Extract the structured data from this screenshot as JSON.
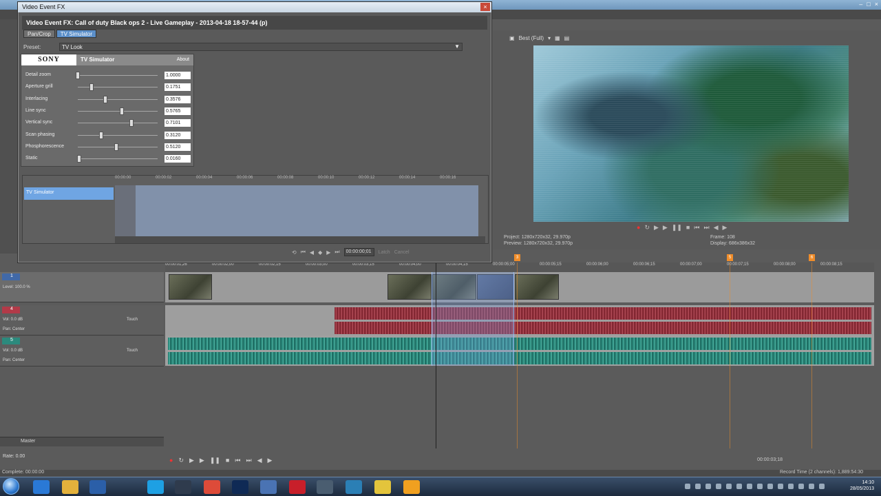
{
  "app": {
    "titlebar_text": ""
  },
  "fx_dialog": {
    "title": "Video Event FX",
    "close": "×",
    "header": "Video Event FX:  Call of duty Black ops 2 - Live Gameplay - 2013-04-18 18-57-44 (p)",
    "chain": [
      {
        "label": "Pan/Crop"
      },
      {
        "label": "TV Simulator"
      }
    ],
    "preset_label": "Preset:",
    "preset_value": "TV Look",
    "plugin": {
      "brand": "SONY",
      "name": "TV Simulator",
      "about": "About",
      "params": [
        {
          "label": "Detail zoom",
          "value": "1.0000",
          "level": 0.0
        },
        {
          "label": "Aperture grill",
          "value": "0.1751",
          "level": 0.18
        },
        {
          "label": "Interlacing",
          "value": "0.3576",
          "level": 0.36
        },
        {
          "label": "Line sync",
          "value": "0.5765",
          "level": 0.58
        },
        {
          "label": "Vertical sync",
          "value": "0.7101",
          "level": 0.71
        },
        {
          "label": "Scan phasing",
          "value": "0.3120",
          "level": 0.31
        },
        {
          "label": "Phosphorescence",
          "value": "0.5120",
          "level": 0.51
        },
        {
          "label": "Static",
          "value": "0.0160",
          "level": 0.02
        }
      ]
    },
    "keyframes": {
      "track_label": "TV Simulator",
      "ruler": [
        "00:00:00",
        "00:00:02",
        "00:00:04",
        "00:00:06",
        "00:00:08",
        "00:00:10",
        "00:00:12",
        "00:00:14",
        "00:00:16"
      ]
    },
    "time_value": "00:00:00;01",
    "latch": "Latch",
    "cancel": "Cancel"
  },
  "preview": {
    "quality": "Best (Full)",
    "project_label": "Project:",
    "project_value": "1280x720x32, 29.970p",
    "preview_label": "Preview:",
    "preview_value": "1280x720x32, 29.970p",
    "frame_label": "Frame:",
    "frame_value": "108",
    "display_label": "Display:",
    "display_value": "686x386x32"
  },
  "timeline": {
    "ruler": [
      "00:00:01;26",
      "00:00:02;00",
      "00:00:02;15",
      "00:00:03;00",
      "00:00:03;15",
      "00:00:04;00",
      "00:00:04;15",
      "00:00:05;00",
      "00:00:05;15",
      "00:00:06;00",
      "00:00:06;15",
      "00:00:07;00",
      "00:00:07;15",
      "00:00:08;00",
      "00:00:08;15"
    ],
    "markers": [
      "3",
      "5",
      "6"
    ],
    "tracks": [
      {
        "num": "1",
        "line1": "Level: 100.0 %"
      },
      {
        "num": "4",
        "line1": "Vol:      0.0 dB",
        "line2": "Pan:      Center",
        "mode": "Touch"
      },
      {
        "num": "5",
        "line1": "Vol:      0.0 dB",
        "line2": "Pan:      Center",
        "mode": "Touch"
      }
    ],
    "master_label": "Master",
    "rate": "Rate: 0.00",
    "time_display": "00:00:03;18",
    "status": "Complete: 00:00:00",
    "record_time": "Record Time (2 channels): 1,889:54:30"
  },
  "taskbar": {
    "clock_time": "14:10",
    "clock_date": "28/05/2013",
    "apps": [
      "start",
      "internet-explorer",
      "file-explorer",
      "media-player",
      "skype",
      "steam",
      "chrome",
      "photoshop",
      "vegas",
      "itunes",
      "app",
      "hamachi",
      "norton",
      "notepad"
    ]
  }
}
